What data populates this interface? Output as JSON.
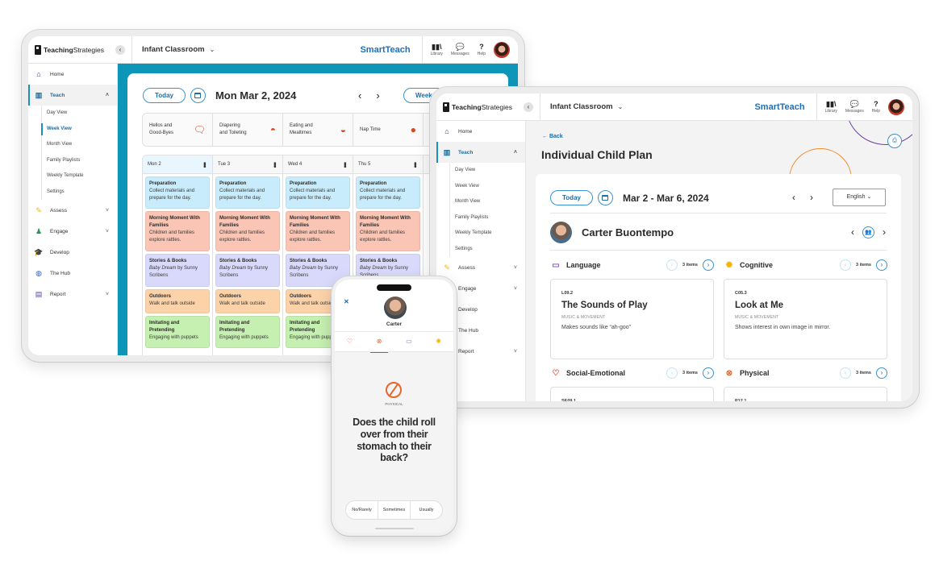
{
  "brand": {
    "logo_bold": "Teaching",
    "logo_regular": "Strategies",
    "product": "SmartTeach",
    "classroom": "Infant Classroom"
  },
  "header_tools": [
    {
      "label": "Library",
      "icon": "library-icon"
    },
    {
      "label": "Messages",
      "icon": "messages-icon"
    },
    {
      "label": "Help",
      "icon": "help-icon"
    }
  ],
  "sidebar": {
    "items": [
      {
        "label": "Home",
        "icon": "home-icon"
      },
      {
        "label": "Teach",
        "icon": "teach-icon"
      },
      {
        "label": "Assess",
        "icon": "assess-icon"
      },
      {
        "label": "Engage",
        "icon": "engage-icon"
      },
      {
        "label": "Develop",
        "icon": "develop-icon"
      },
      {
        "label": "The Hub",
        "icon": "hub-icon"
      },
      {
        "label": "Report",
        "icon": "report-icon"
      }
    ],
    "teach_subitems": [
      "Day View",
      "Week View",
      "Month View",
      "Family Playlists",
      "Weekly Template",
      "Settings"
    ]
  },
  "week_view": {
    "today_label": "Today",
    "date_title": "Mon Mar 2, 2024",
    "view_toggle": "Week",
    "routines": [
      {
        "label_line1": "Hellos and",
        "label_line2": "Good-Byes",
        "icon": "greeting-icon"
      },
      {
        "label_line1": "Diapering",
        "label_line2": "and Toileting",
        "icon": "diaper-icon"
      },
      {
        "label_line1": "Eating and",
        "label_line2": "Mealtimes",
        "icon": "bowl-icon"
      },
      {
        "label_line1": "Nap Time",
        "label_line2": "",
        "icon": "nap-icon"
      }
    ],
    "days": [
      {
        "label": "Mon 2"
      },
      {
        "label": "Tue 3"
      },
      {
        "label": "Wed 4"
      },
      {
        "label": "Thu 5"
      }
    ],
    "activities": [
      {
        "title": "Preparation",
        "desc": "Collect materials and prepare for the day.",
        "color": "#c8ecfb"
      },
      {
        "title": "Morning Moment With Families",
        "desc": "Children and families explore rattles.",
        "color": "#fac5b4"
      },
      {
        "title": "Stories & Books",
        "desc_italic": "Baby Dream",
        "desc": " by Sunny Scribens",
        "color": "#d9d9fb"
      },
      {
        "title": "Outdoors",
        "desc": "Walk and talk outside",
        "color": "#fcd2a9"
      },
      {
        "title": "Imitating and Pretending",
        "desc": "Engaging with puppets",
        "color": "#c6efb2"
      }
    ]
  },
  "child_plan": {
    "back_label": "Back",
    "page_title": "Individual Child Plan",
    "today_label": "Today",
    "date_range": "Mar 2 - Mar 6, 2024",
    "language_select": "English",
    "child_name": "Carter Buontempo",
    "domains": [
      {
        "name": "Language",
        "icon": "speech-bubble-icon",
        "count": "3 items",
        "code": "L09.2",
        "title": "The Sounds of Play",
        "category": "MUSIC & MOVEMENT",
        "desc": "Makes sounds like “ah-goo”"
      },
      {
        "name": "Cognitive",
        "icon": "lightbulb-icon",
        "count": "3 items",
        "code": "C05.3",
        "title": "Look at Me",
        "category": "MUSIC & MOVEMENT",
        "desc": "Shows interest in own image in mirror."
      },
      {
        "name": "Social-Emotional",
        "icon": "heart-icon",
        "count": "3 items",
        "code": "SE09.1"
      },
      {
        "name": "Physical",
        "icon": "ball-icon",
        "count": "3 items",
        "code": "P12.1"
      }
    ]
  },
  "phone": {
    "child_name": "Carter",
    "category": "PHYSICAL",
    "question": "Does the child roll over from their stomach to their back?",
    "answers": [
      "No/Rarely",
      "Sometimes",
      "Usually"
    ]
  },
  "colors": {
    "teal": "#0e96b8",
    "accent_blue": "#1c6ea6",
    "orange": "#e8662a",
    "purple": "#6b3fa0"
  }
}
